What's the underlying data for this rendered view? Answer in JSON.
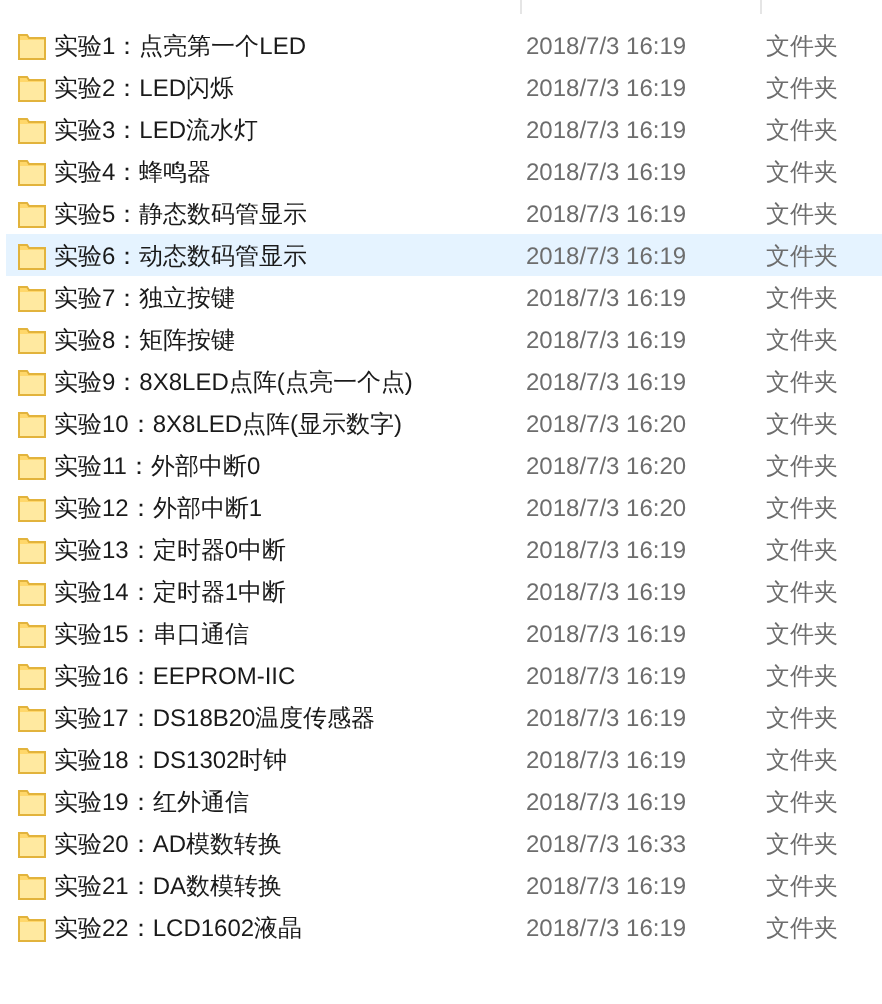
{
  "files": [
    {
      "name": "实验1：点亮第一个LED",
      "modified": "2018/7/3 16:19",
      "type": "文件夹",
      "selected": false
    },
    {
      "name": "实验2：LED闪烁",
      "modified": "2018/7/3 16:19",
      "type": "文件夹",
      "selected": false
    },
    {
      "name": "实验3：LED流水灯",
      "modified": "2018/7/3 16:19",
      "type": "文件夹",
      "selected": false
    },
    {
      "name": "实验4：蜂鸣器",
      "modified": "2018/7/3 16:19",
      "type": "文件夹",
      "selected": false
    },
    {
      "name": "实验5：静态数码管显示",
      "modified": "2018/7/3 16:19",
      "type": "文件夹",
      "selected": false
    },
    {
      "name": "实验6：动态数码管显示",
      "modified": "2018/7/3 16:19",
      "type": "文件夹",
      "selected": true
    },
    {
      "name": "实验7：独立按键",
      "modified": "2018/7/3 16:19",
      "type": "文件夹",
      "selected": false
    },
    {
      "name": "实验8：矩阵按键",
      "modified": "2018/7/3 16:19",
      "type": "文件夹",
      "selected": false
    },
    {
      "name": "实验9：8X8LED点阵(点亮一个点)",
      "modified": "2018/7/3 16:19",
      "type": "文件夹",
      "selected": false
    },
    {
      "name": "实验10：8X8LED点阵(显示数字)",
      "modified": "2018/7/3 16:20",
      "type": "文件夹",
      "selected": false
    },
    {
      "name": "实验11：外部中断0",
      "modified": "2018/7/3 16:20",
      "type": "文件夹",
      "selected": false
    },
    {
      "name": "实验12：外部中断1",
      "modified": "2018/7/3 16:20",
      "type": "文件夹",
      "selected": false
    },
    {
      "name": "实验13：定时器0中断",
      "modified": "2018/7/3 16:19",
      "type": "文件夹",
      "selected": false
    },
    {
      "name": "实验14：定时器1中断",
      "modified": "2018/7/3 16:19",
      "type": "文件夹",
      "selected": false
    },
    {
      "name": "实验15：串口通信",
      "modified": "2018/7/3 16:19",
      "type": "文件夹",
      "selected": false
    },
    {
      "name": "实验16：EEPROM-IIC",
      "modified": "2018/7/3 16:19",
      "type": "文件夹",
      "selected": false
    },
    {
      "name": "实验17：DS18B20温度传感器",
      "modified": "2018/7/3 16:19",
      "type": "文件夹",
      "selected": false
    },
    {
      "name": "实验18：DS1302时钟",
      "modified": "2018/7/3 16:19",
      "type": "文件夹",
      "selected": false
    },
    {
      "name": "实验19：红外通信",
      "modified": "2018/7/3 16:19",
      "type": "文件夹",
      "selected": false
    },
    {
      "name": "实验20：AD模数转换",
      "modified": "2018/7/3 16:33",
      "type": "文件夹",
      "selected": false
    },
    {
      "name": "实验21：DA数模转换",
      "modified": "2018/7/3 16:19",
      "type": "文件夹",
      "selected": false
    },
    {
      "name": "实验22：LCD1602液晶",
      "modified": "2018/7/3 16:19",
      "type": "文件夹",
      "selected": false
    }
  ]
}
